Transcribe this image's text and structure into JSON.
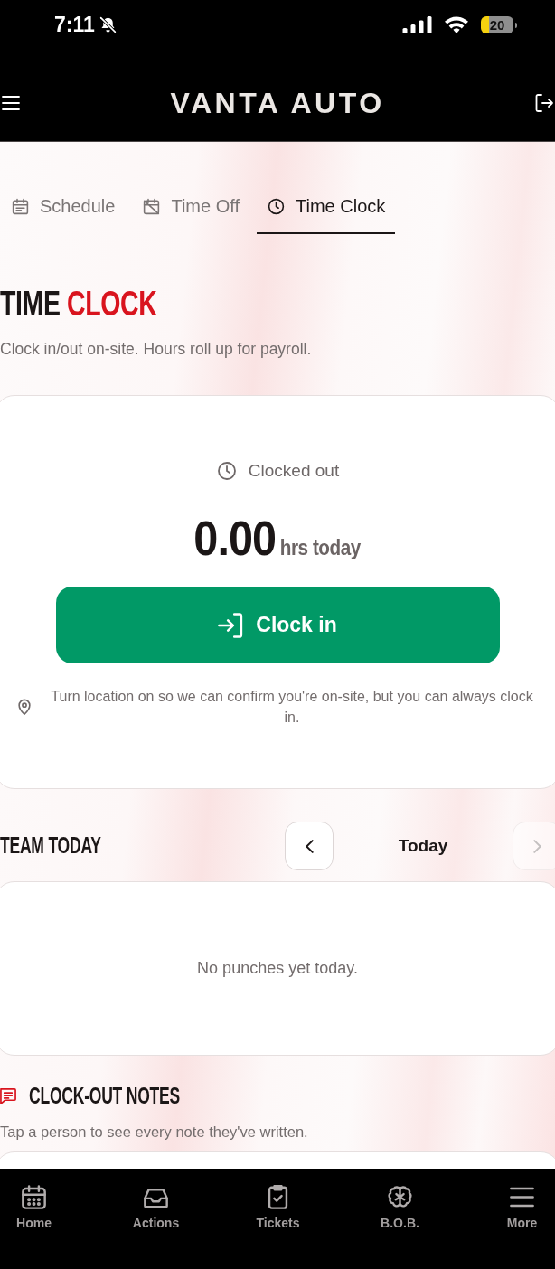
{
  "status_bar": {
    "time": "7:11",
    "battery": "20"
  },
  "header": {
    "title": "VANTA AUTO"
  },
  "tabs": [
    {
      "label": "Schedule",
      "selected": false
    },
    {
      "label": "Time Off",
      "selected": false
    },
    {
      "label": "Time Clock",
      "selected": true
    }
  ],
  "page": {
    "title": [
      {
        "text": "TIME",
        "accent": false
      },
      {
        "text": "CLOCK",
        "accent": true
      }
    ],
    "subtitle": "Clock in/out on-site. Hours roll up for payroll."
  },
  "clock_card": {
    "status": "Clocked out",
    "hours": "0.00",
    "hours_unit": "hrs today",
    "button": "Clock in",
    "location_note": "Turn location on so we can confirm you're on-site, but you can always clock in."
  },
  "team_today": {
    "title": "TEAM TODAY",
    "previous_button": {
      "disabled": false
    },
    "date_label": "Today",
    "next_button": {
      "disabled": true
    },
    "empty_message": "No punches yet today."
  },
  "clock_out_notes": {
    "title": "CLOCK-OUT NOTES",
    "hint": "Tap a person to see every note they've written."
  },
  "bottom_nav": [
    {
      "label": "Home"
    },
    {
      "label": "Actions"
    },
    {
      "label": "Tickets"
    },
    {
      "label": "B.O.B."
    },
    {
      "label": "More"
    }
  ]
}
